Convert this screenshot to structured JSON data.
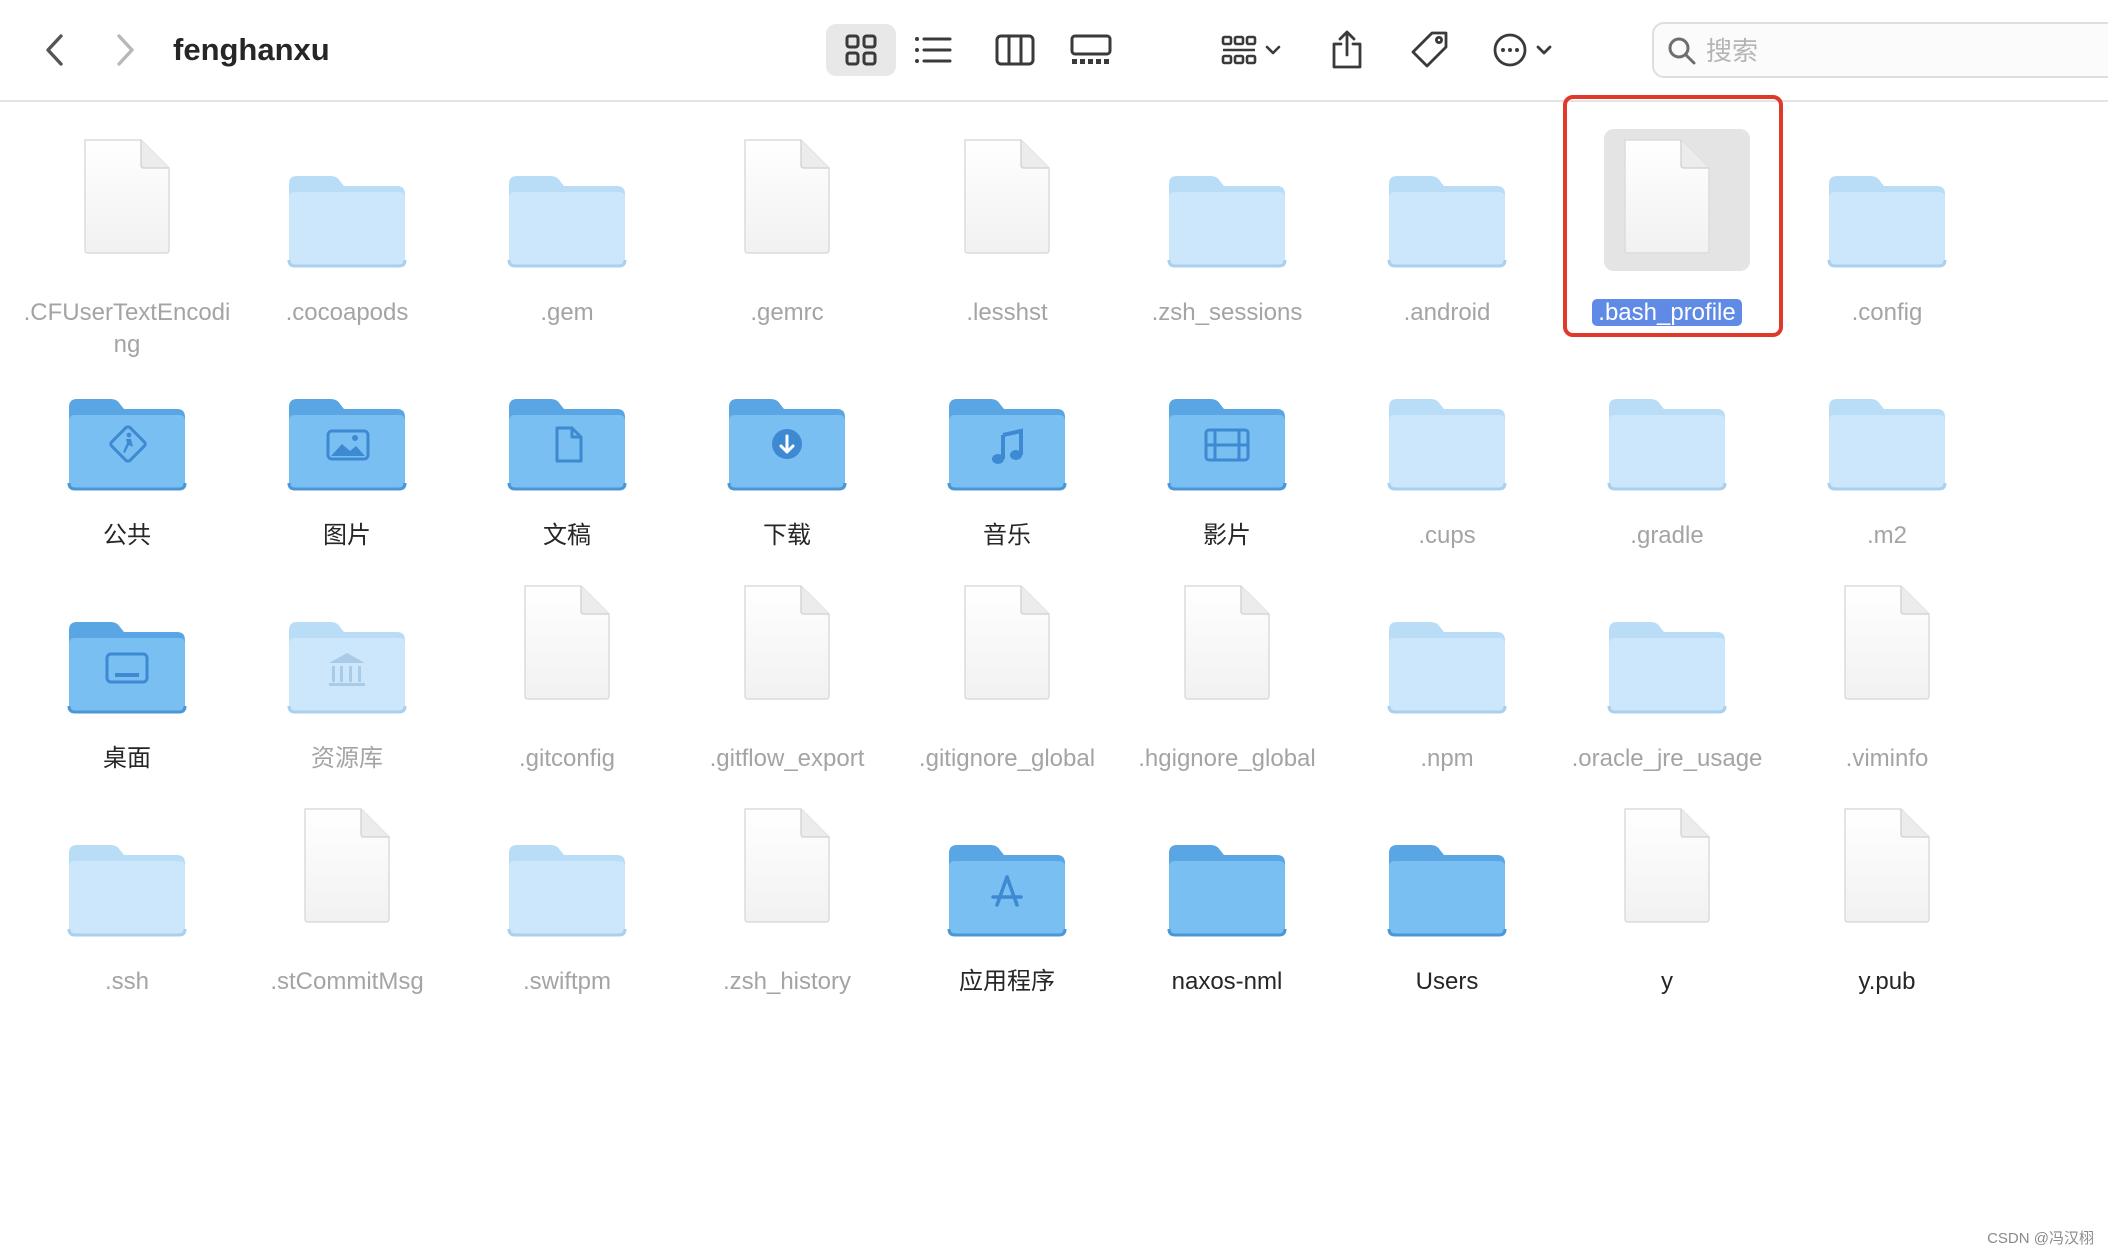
{
  "window": {
    "title": "fenghanxu"
  },
  "toolbar": {
    "back_icon": "chevron-left-icon",
    "forward_icon": "chevron-right-icon",
    "views": [
      "grid-view-icon",
      "list-view-icon",
      "column-view-icon",
      "gallery-view-icon"
    ],
    "active_view": "grid-view-icon",
    "group_icon": "group-icon",
    "share_icon": "share-icon",
    "tag_icon": "tag-icon",
    "more_icon": "more-icon"
  },
  "search": {
    "placeholder": "搜索"
  },
  "colors": {
    "folder_light": "#c7e4fa",
    "folder_dark": "#6ab3ec",
    "selection": "#5f8be6",
    "highlight_box": "#e0392b",
    "hidden_label": "#a4a4a4"
  },
  "files": [
    {
      "name": ".CFUserTextEncoding",
      "kind": "doc",
      "hidden": true
    },
    {
      "name": ".cocoapods",
      "kind": "folder-light",
      "hidden": true
    },
    {
      "name": ".gem",
      "kind": "folder-light",
      "hidden": true
    },
    {
      "name": ".gemrc",
      "kind": "doc",
      "hidden": true
    },
    {
      "name": ".lesshst",
      "kind": "doc",
      "hidden": true
    },
    {
      "name": ".zsh_sessions",
      "kind": "folder-light",
      "hidden": true
    },
    {
      "name": ".android",
      "kind": "folder-light",
      "hidden": true
    },
    {
      "name": ".bash_profile",
      "kind": "doc",
      "hidden": true,
      "selected": true
    },
    {
      "name": ".config",
      "kind": "folder-light",
      "hidden": true
    },
    {
      "name": "公共",
      "kind": "folder-public",
      "hidden": false
    },
    {
      "name": "图片",
      "kind": "folder-pictures",
      "hidden": false
    },
    {
      "name": "文稿",
      "kind": "folder-documents",
      "hidden": false
    },
    {
      "name": "下载",
      "kind": "folder-downloads",
      "hidden": false
    },
    {
      "name": "音乐",
      "kind": "folder-music",
      "hidden": false
    },
    {
      "name": "影片",
      "kind": "folder-movies",
      "hidden": false
    },
    {
      "name": ".cups",
      "kind": "folder-light",
      "hidden": true
    },
    {
      "name": ".gradle",
      "kind": "folder-light",
      "hidden": true
    },
    {
      "name": ".m2",
      "kind": "folder-light",
      "hidden": true
    },
    {
      "name": "桌面",
      "kind": "folder-desktop",
      "hidden": false
    },
    {
      "name": "资源库",
      "kind": "folder-library",
      "hidden": true
    },
    {
      "name": ".gitconfig",
      "kind": "doc",
      "hidden": true
    },
    {
      "name": ".gitflow_export",
      "kind": "doc",
      "hidden": true
    },
    {
      "name": ".gitignore_global",
      "kind": "doc",
      "hidden": true
    },
    {
      "name": ".hgignore_global",
      "kind": "doc",
      "hidden": true
    },
    {
      "name": ".npm",
      "kind": "folder-light",
      "hidden": true
    },
    {
      "name": ".oracle_jre_usage",
      "kind": "folder-light",
      "hidden": true
    },
    {
      "name": ".viminfo",
      "kind": "doc",
      "hidden": true
    },
    {
      "name": ".ssh",
      "kind": "folder-light",
      "hidden": true
    },
    {
      "name": ".stCommitMsg",
      "kind": "doc",
      "hidden": true
    },
    {
      "name": ".swiftpm",
      "kind": "folder-light",
      "hidden": true
    },
    {
      "name": ".zsh_history",
      "kind": "doc",
      "hidden": true
    },
    {
      "name": "应用程序",
      "kind": "folder-apps",
      "hidden": false
    },
    {
      "name": "naxos-nml",
      "kind": "folder-dark",
      "hidden": false
    },
    {
      "name": "Users",
      "kind": "folder-dark",
      "hidden": false
    },
    {
      "name": "y",
      "kind": "doc",
      "hidden": false
    },
    {
      "name": "y.pub",
      "kind": "doc",
      "hidden": false
    }
  ],
  "watermark": "CSDN @冯汉栩"
}
